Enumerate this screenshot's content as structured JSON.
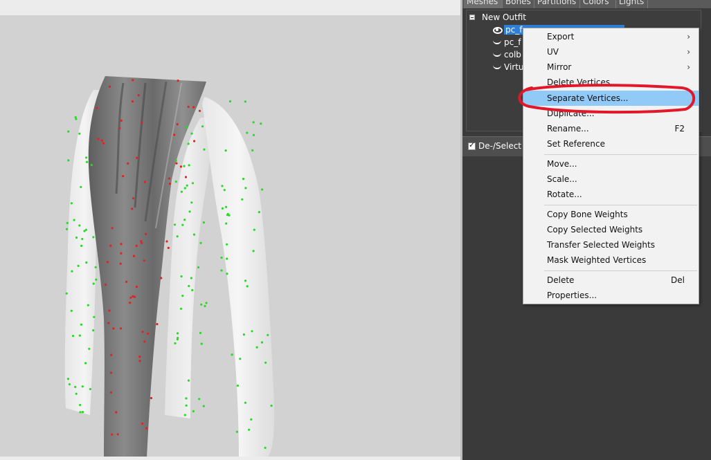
{
  "tabs": [
    "Meshes",
    "Bones",
    "Partitions",
    "Colors",
    "Lights"
  ],
  "tree": {
    "root": "New Outfit",
    "items": [
      {
        "label": "pc_f",
        "visibility_icon": "eye-open-icon",
        "selected": true
      },
      {
        "label": "pc_f",
        "visibility_icon": "eye-closed-icon",
        "selected": false
      },
      {
        "label": "colb",
        "visibility_icon": "eye-closed-icon",
        "selected": false
      },
      {
        "label": "Virtu",
        "visibility_icon": "eye-closed-icon",
        "selected": false
      }
    ]
  },
  "deselect": {
    "label": "De-/Select",
    "checked": true
  },
  "context_menu": {
    "items": [
      {
        "label": "Export",
        "submenu": true
      },
      {
        "label": "UV",
        "submenu": true
      },
      {
        "label": "Mirror",
        "submenu": true
      },
      {
        "label": "Delete Vertices"
      },
      {
        "label": "Separate Vertices...",
        "highlighted": true
      },
      {
        "label": "Duplicate..."
      },
      {
        "label": "Rename...",
        "shortcut": "F2"
      },
      {
        "label": "Set Reference"
      },
      {
        "label": "Move..."
      },
      {
        "label": "Scale..."
      },
      {
        "label": "Rotate..."
      },
      {
        "label": "Copy Bone Weights"
      },
      {
        "label": "Copy Selected Weights"
      },
      {
        "label": "Transfer Selected Weights"
      },
      {
        "label": "Mask Weighted Vertices"
      },
      {
        "label": "Delete",
        "shortcut": "Del"
      },
      {
        "label": "Properties..."
      }
    ]
  },
  "colors": {
    "highlight": "#91c9f7",
    "selection": "#2f7fd6",
    "annotation": "#e0182a",
    "vertex_selected": "#e52020",
    "vertex_unselected": "#22dd22"
  }
}
